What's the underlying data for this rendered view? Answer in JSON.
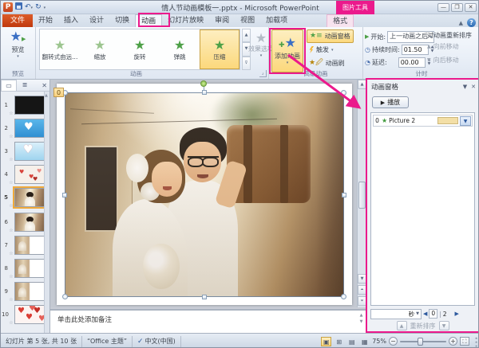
{
  "title_bar": {
    "app_initial": "P",
    "title": "情人节动画模板一.pptx - Microsoft PowerPoint",
    "contextual_group": "图片工具"
  },
  "tabs": [
    {
      "label": "文件"
    },
    {
      "label": "开始"
    },
    {
      "label": "插入"
    },
    {
      "label": "设计"
    },
    {
      "label": "切换"
    },
    {
      "label": "动画"
    },
    {
      "label": "幻灯片放映"
    },
    {
      "label": "审阅"
    },
    {
      "label": "视图"
    },
    {
      "label": "加载项"
    },
    {
      "label": "格式"
    }
  ],
  "ribbon": {
    "preview": {
      "button": "预览",
      "group": "预览"
    },
    "animation": {
      "gallery": [
        {
          "label": "翻转式由远..."
        },
        {
          "label": "缩放"
        },
        {
          "label": "旋转"
        },
        {
          "label": "弹跳"
        },
        {
          "label": "压缩"
        }
      ],
      "effect_options": "效果选项",
      "group": "动画"
    },
    "advanced": {
      "add_animation": "添加动画",
      "animation_pane": "动画窗格",
      "trigger": "触发",
      "animation_painter": "动画刷",
      "group": "高级动画"
    },
    "timing": {
      "start_label": "开始:",
      "start_value": "上一动画之后",
      "duration_label": "持续时间:",
      "duration_value": "01.50",
      "delay_label": "延迟:",
      "delay_value": "00.00",
      "reorder_title": "对动画重新排序",
      "move_earlier": "向前移动",
      "move_later": "向后移动",
      "group": "计时"
    }
  },
  "slides": [
    {
      "num": "1"
    },
    {
      "num": "2"
    },
    {
      "num": "3"
    },
    {
      "num": "4"
    },
    {
      "num": "5"
    },
    {
      "num": "6"
    },
    {
      "num": "7"
    },
    {
      "num": "8"
    },
    {
      "num": "9"
    },
    {
      "num": "10"
    }
  ],
  "slide_badge": "0",
  "notes_placeholder": "单击此处添加备注",
  "animation_pane": {
    "title": "动画窗格",
    "play_button": "播放",
    "item": {
      "order": "0",
      "name": "Picture 2"
    },
    "unit": "秒",
    "scale_start": "0",
    "scale_end": "2",
    "reorder_label": "重新排序"
  },
  "status_bar": {
    "slide_info": "幻灯片 第 5 张, 共 10 张",
    "theme": "“Office 主题”",
    "language": "中文(中国)",
    "zoom": "75%"
  },
  "colors": {
    "annotation_pink": "#eb1a8c",
    "selection_orange": "#fcd87c",
    "file_tab_orange": "#c0390e"
  }
}
